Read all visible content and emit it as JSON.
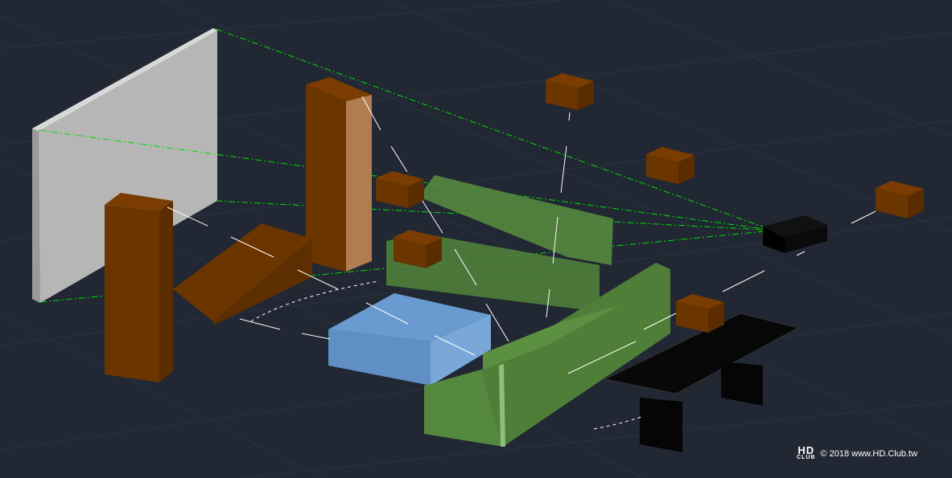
{
  "watermark": {
    "logo_top": "HD",
    "logo_bottom": "CLUB",
    "text": "© 2018 www.HD.Club.tw"
  },
  "colors": {
    "background": "#212733",
    "grid": "#2d3441",
    "screen": "#b4b4b4",
    "speaker": "#6b3500",
    "sofa": "#55883f",
    "table": "#6495c8",
    "projector": "#050505",
    "sightline": "#00e000"
  }
}
